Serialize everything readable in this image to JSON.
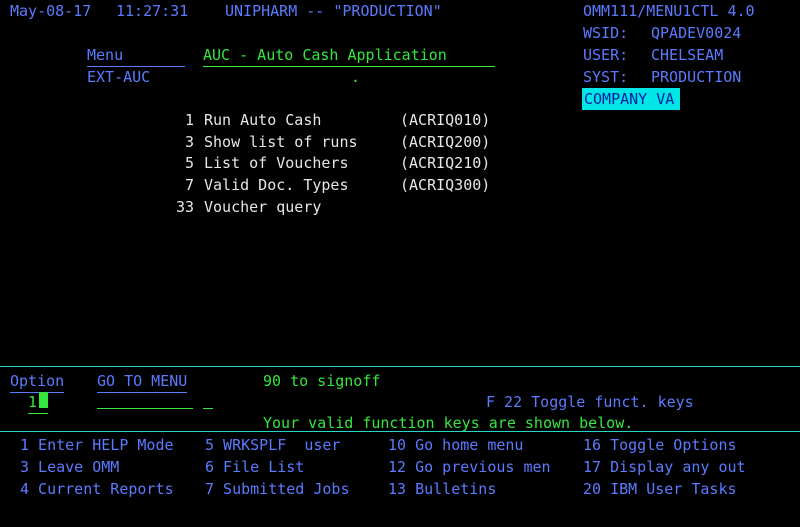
{
  "header": {
    "date": "May-08-17",
    "time": "11:27:31",
    "system": "UNIPHARM -- \"PRODUCTION\"",
    "program": "OMM111/MENU1CTL 4.0",
    "wsid_label": "WSID:",
    "wsid": "QPADEV0024",
    "user_label": "USER:",
    "user": "CHELSEAM",
    "syst_label": "SYST:",
    "syst": "PRODUCTION",
    "company": "COMPANY VA"
  },
  "menu": {
    "label": "Menu",
    "id": "EXT-AUC",
    "title": "AUC - Auto Cash Application",
    "dot": ".",
    "items": [
      {
        "num": "1",
        "label": "Run Auto Cash",
        "code": "(ACRIQ010)"
      },
      {
        "num": "3",
        "label": "Show list of runs",
        "code": "(ACRIQ200)"
      },
      {
        "num": "5",
        "label": "List of Vouchers",
        "code": "(ACRIQ210)"
      },
      {
        "num": "7",
        "label": "Valid Doc. Types",
        "code": "(ACRIQ300)"
      },
      {
        "num": "33",
        "label": "Voucher query",
        "code": ""
      }
    ]
  },
  "prompt": {
    "option_label": "Option",
    "goto_label": "GO TO MENU",
    "signoff": "90 to signoff",
    "option_value": "1",
    "toggle": "F 22 Toggle funct. keys",
    "valid_keys": "Your valid function keys are shown below."
  },
  "fkeys": [
    [
      "1 Enter HELP Mode",
      "5 WRKSPLF  user",
      "10 Go home menu",
      "16 Toggle Options"
    ],
    [
      "3 Leave OMM",
      "6 File List",
      "12 Go previous men",
      "17 Display any out"
    ],
    [
      "4 Current Reports",
      "7 Submitted Jobs",
      "13 Bulletins",
      "20 IBM User Tasks"
    ]
  ]
}
